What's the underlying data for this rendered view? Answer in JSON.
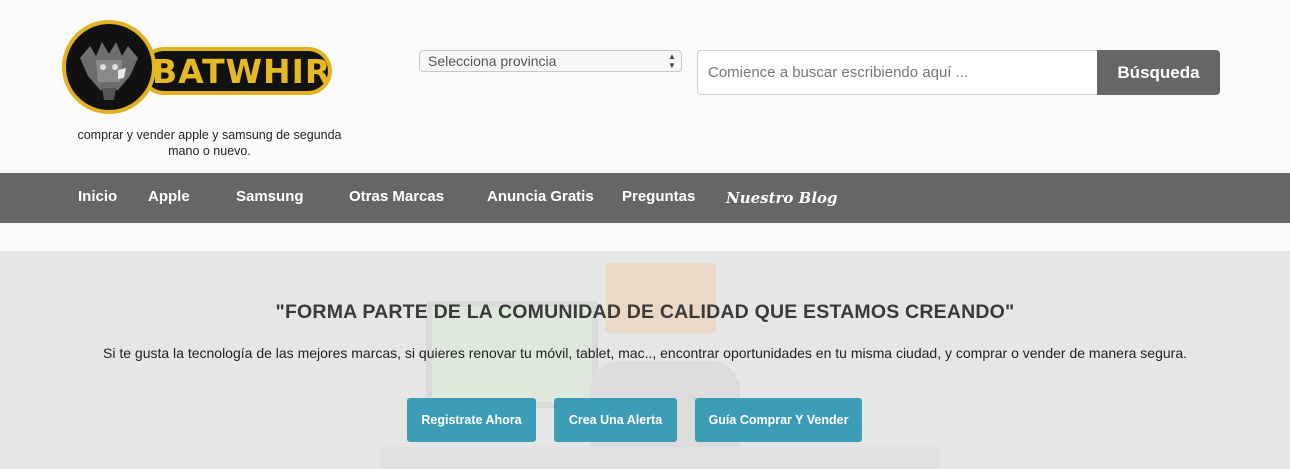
{
  "brand": {
    "logo_text": "BATWHIR",
    "tagline": "comprar y vender apple y samsung de segunda mano o nuevo.",
    "colors": {
      "gold": "#e2b320",
      "dark": "#111111"
    }
  },
  "header": {
    "province_select": {
      "value": "Selecciona provincia"
    },
    "search": {
      "placeholder": "Comience a buscar escribiendo aquí ...",
      "value": "",
      "button_label": "Búsqueda"
    }
  },
  "nav": {
    "items": [
      {
        "label": "Inicio"
      },
      {
        "label": "Apple"
      },
      {
        "label": "Samsung"
      },
      {
        "label": "Otras Marcas"
      },
      {
        "label": "Anuncia Gratis"
      },
      {
        "label": "Preguntas"
      },
      {
        "label": "Nuestro Blog"
      }
    ],
    "background": "#666666"
  },
  "hero": {
    "title": "\"FORMA PARTE DE LA COMUNIDAD DE CALIDAD QUE ESTAMOS CREANDO\"",
    "text": "Si te gusta la tecnología de las mejores marcas, si quieres renovar tu móvil, tablet, mac.., encontrar oportunidades en tu misma ciudad, y comprar o vender de manera segura.",
    "buttons": [
      {
        "label": "Registrate Ahora"
      },
      {
        "label": "Crea Una Alerta"
      },
      {
        "label": "Guía Comprar Y Vender"
      }
    ],
    "accent": "#3d9db7"
  }
}
